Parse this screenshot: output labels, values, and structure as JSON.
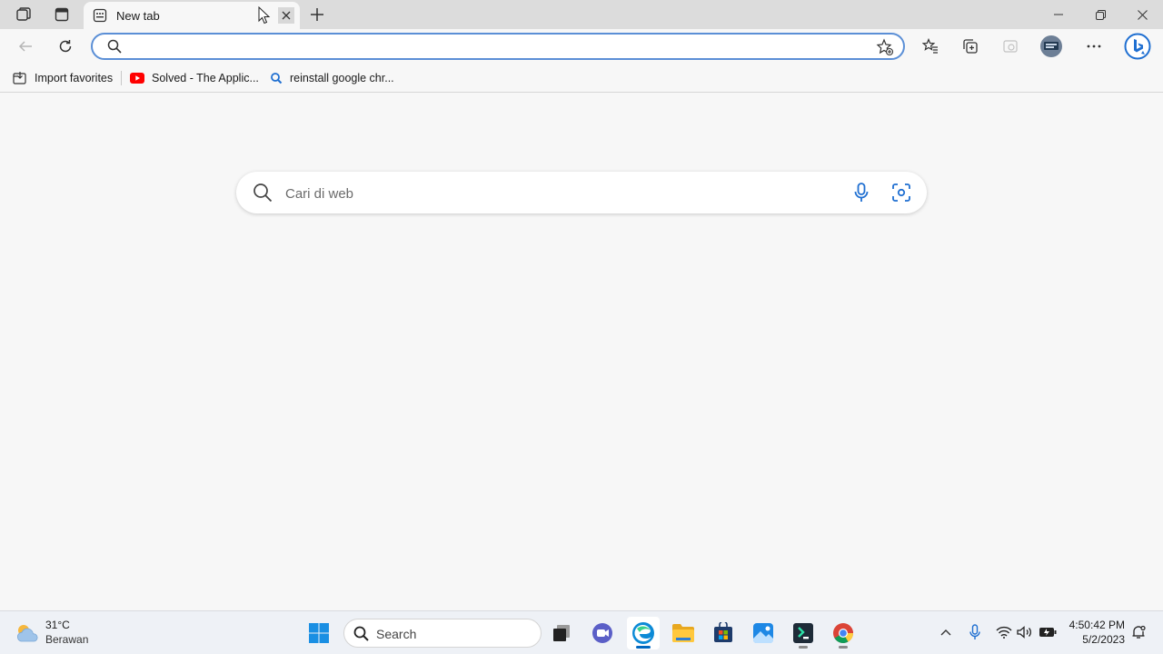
{
  "browser": {
    "tab": {
      "title": "New tab"
    },
    "address_bar": {
      "value": "",
      "placeholder": ""
    },
    "favorites": [
      {
        "label": "Import favorites",
        "icon": "import-favorites-icon"
      },
      {
        "label": "Solved - The Applic...",
        "icon": "youtube-icon"
      },
      {
        "label": "reinstall google chr...",
        "icon": "search-icon"
      }
    ]
  },
  "new_tab_page": {
    "search_placeholder": "Cari di web"
  },
  "taskbar": {
    "weather": {
      "temp": "31°C",
      "desc": "Berawan"
    },
    "search_label": "Search",
    "clock": {
      "time": "4:50:42 PM",
      "date": "5/2/2023"
    },
    "apps": [
      "task-view",
      "teams-chat",
      "microsoft-edge",
      "file-explorer",
      "microsoft-store",
      "photos",
      "terminal",
      "google-chrome"
    ]
  },
  "colors": {
    "accent": "#0067c0",
    "address_focus": "#5b8fd6",
    "page_bg": "#f7f7f7",
    "tabstrip_bg": "#dcdcdc"
  }
}
